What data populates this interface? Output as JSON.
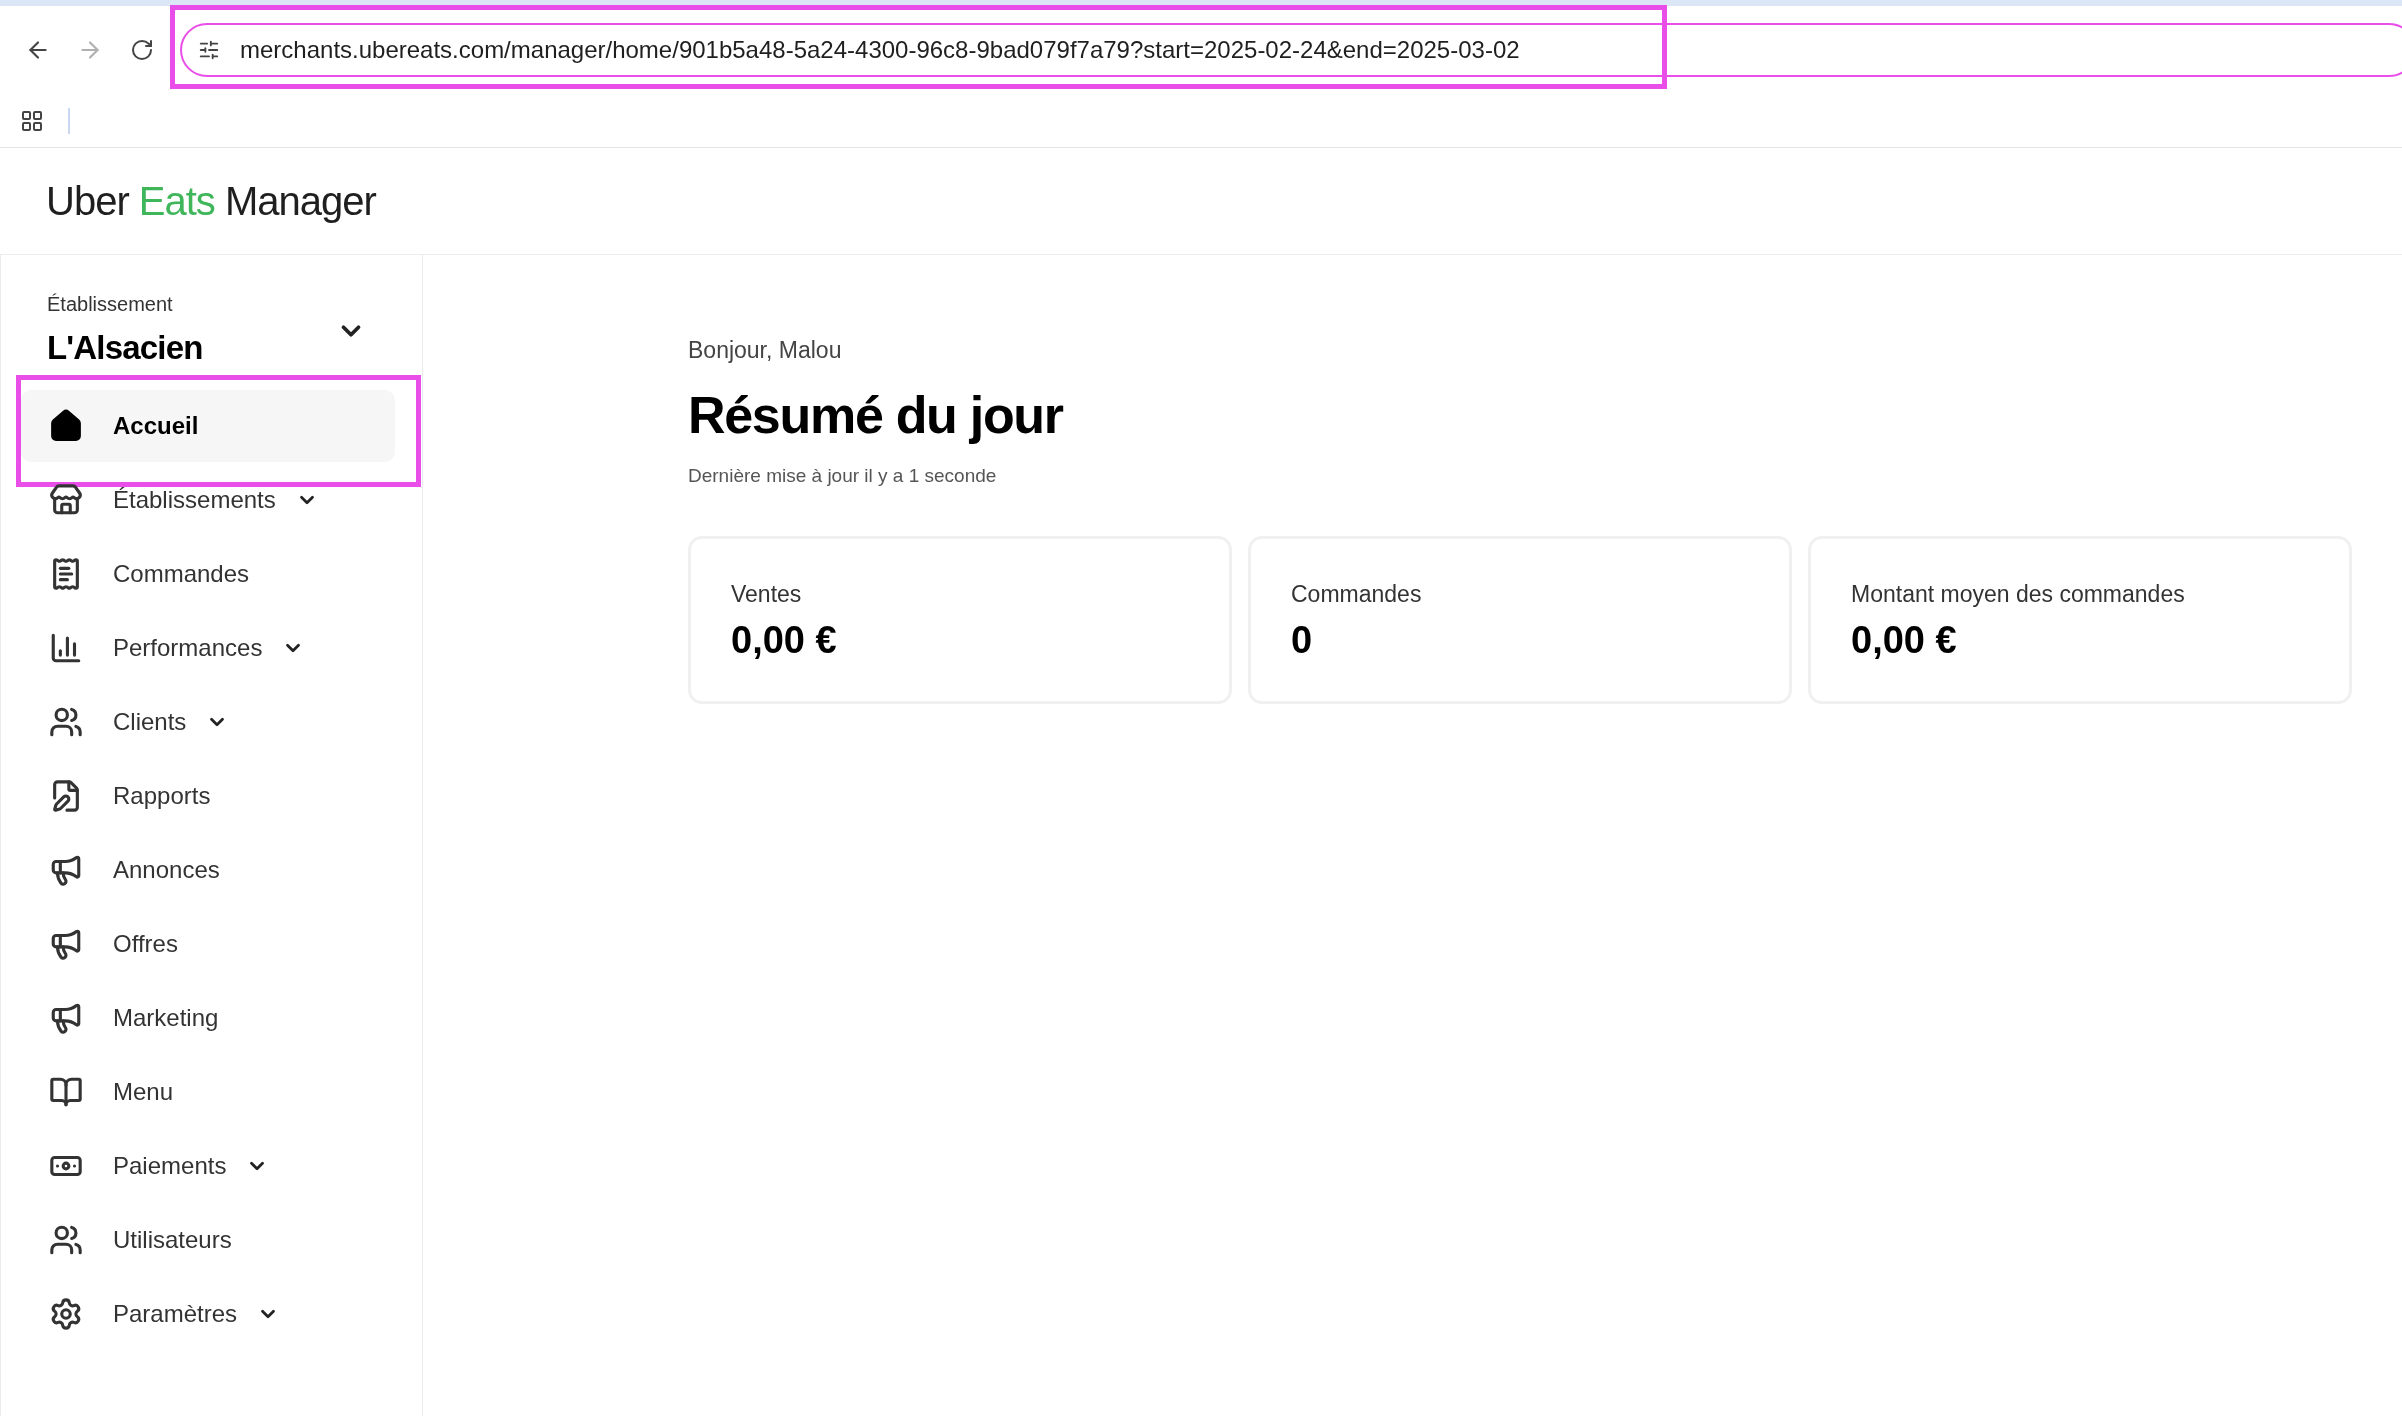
{
  "browser": {
    "url": "merchants.ubereats.com/manager/home/901b5a48-5a24-4300-96c8-9bad079f7a79?start=2025-02-24&end=2025-03-02",
    "url_highlighted": true,
    "forward_disabled": true
  },
  "logo": {
    "part_1": "Uber",
    "part_2": "Eats",
    "part_3": "Manager"
  },
  "store_picker": {
    "label": "Établissement",
    "value": "L'Alsacien"
  },
  "sidebar": {
    "items": [
      {
        "label": "Accueil",
        "selected": true,
        "highlighted": true,
        "expandable": false
      },
      {
        "label": "Établissements",
        "selected": false,
        "highlighted": false,
        "expandable": true
      },
      {
        "label": "Commandes",
        "selected": false,
        "highlighted": false,
        "expandable": false
      },
      {
        "label": "Performances",
        "selected": false,
        "highlighted": false,
        "expandable": true
      },
      {
        "label": "Clients",
        "selected": false,
        "highlighted": false,
        "expandable": true
      },
      {
        "label": "Rapports",
        "selected": false,
        "highlighted": false,
        "expandable": false
      },
      {
        "label": "Annonces",
        "selected": false,
        "highlighted": false,
        "expandable": false
      },
      {
        "label": "Offres",
        "selected": false,
        "highlighted": false,
        "expandable": false
      },
      {
        "label": "Marketing",
        "selected": false,
        "highlighted": false,
        "expandable": false
      },
      {
        "label": "Menu",
        "selected": false,
        "highlighted": false,
        "expandable": false
      },
      {
        "label": "Paiements",
        "selected": false,
        "highlighted": false,
        "expandable": true
      },
      {
        "label": "Utilisateurs",
        "selected": false,
        "highlighted": false,
        "expandable": false
      },
      {
        "label": "Paramètres",
        "selected": false,
        "highlighted": false,
        "expandable": true
      }
    ]
  },
  "main": {
    "greeting": "Bonjour, Malou",
    "title": "Résumé du jour",
    "updated": "Dernière mise à jour il y a 1 seconde",
    "cards": [
      {
        "label": "Ventes",
        "value": "0,00 €"
      },
      {
        "label": "Commandes",
        "value": "0"
      },
      {
        "label": "Montant moyen des commandes",
        "value": "0,00 €"
      }
    ]
  }
}
